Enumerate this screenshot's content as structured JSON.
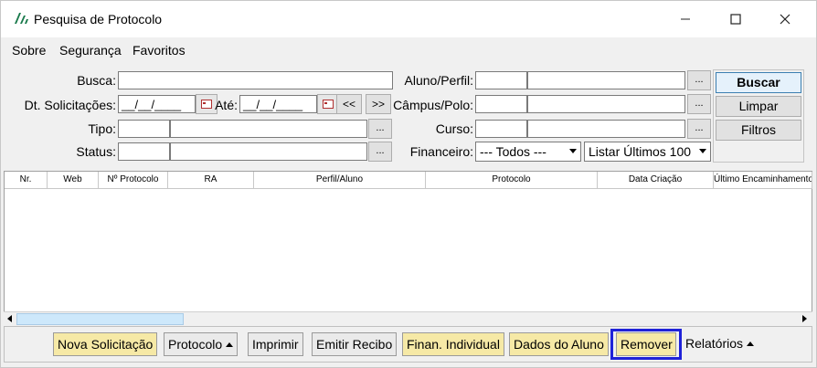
{
  "window": {
    "title": "Pesquisa de Protocolo"
  },
  "menu": [
    "Sobre",
    "Segurança",
    "Favoritos"
  ],
  "form": {
    "busca_label": "Busca:",
    "dt_label": "Dt. Solicitações:",
    "dt_from": "__/__/____",
    "ate_label": "Até:",
    "dt_to": "__/__/____",
    "prev_label": "<<",
    "next_label": ">>",
    "tipo_label": "Tipo:",
    "status_label": "Status:",
    "aluno_label": "Aluno/Perfil:",
    "campus_label": "Câmpus/Polo:",
    "curso_label": "Curso:",
    "financeiro_label": "Financeiro:",
    "financeiro_value": "--- Todos ---",
    "listar_value": "Listar Últimos 100",
    "ellipsis": "..."
  },
  "actions": {
    "buscar": "Buscar",
    "limpar": "Limpar",
    "filtros": "Filtros"
  },
  "columns": [
    "Nr.",
    "Web",
    "Nº Protocolo",
    "RA",
    "Perfil/Aluno",
    "Protocolo",
    "Data Criação",
    "Último Encaminhamento"
  ],
  "toolbar": {
    "nova": "Nova Solicitação",
    "protocolo": "Protocolo",
    "imprimir": "Imprimir",
    "emitir": "Emitir Recibo",
    "finan": "Finan. Individual",
    "dados": "Dados do Aluno",
    "remover": "Remover",
    "relatorios": "Relatórios"
  },
  "colors": {
    "highlight": "#1f22d8",
    "yellow_button": "#f6e9a6"
  }
}
